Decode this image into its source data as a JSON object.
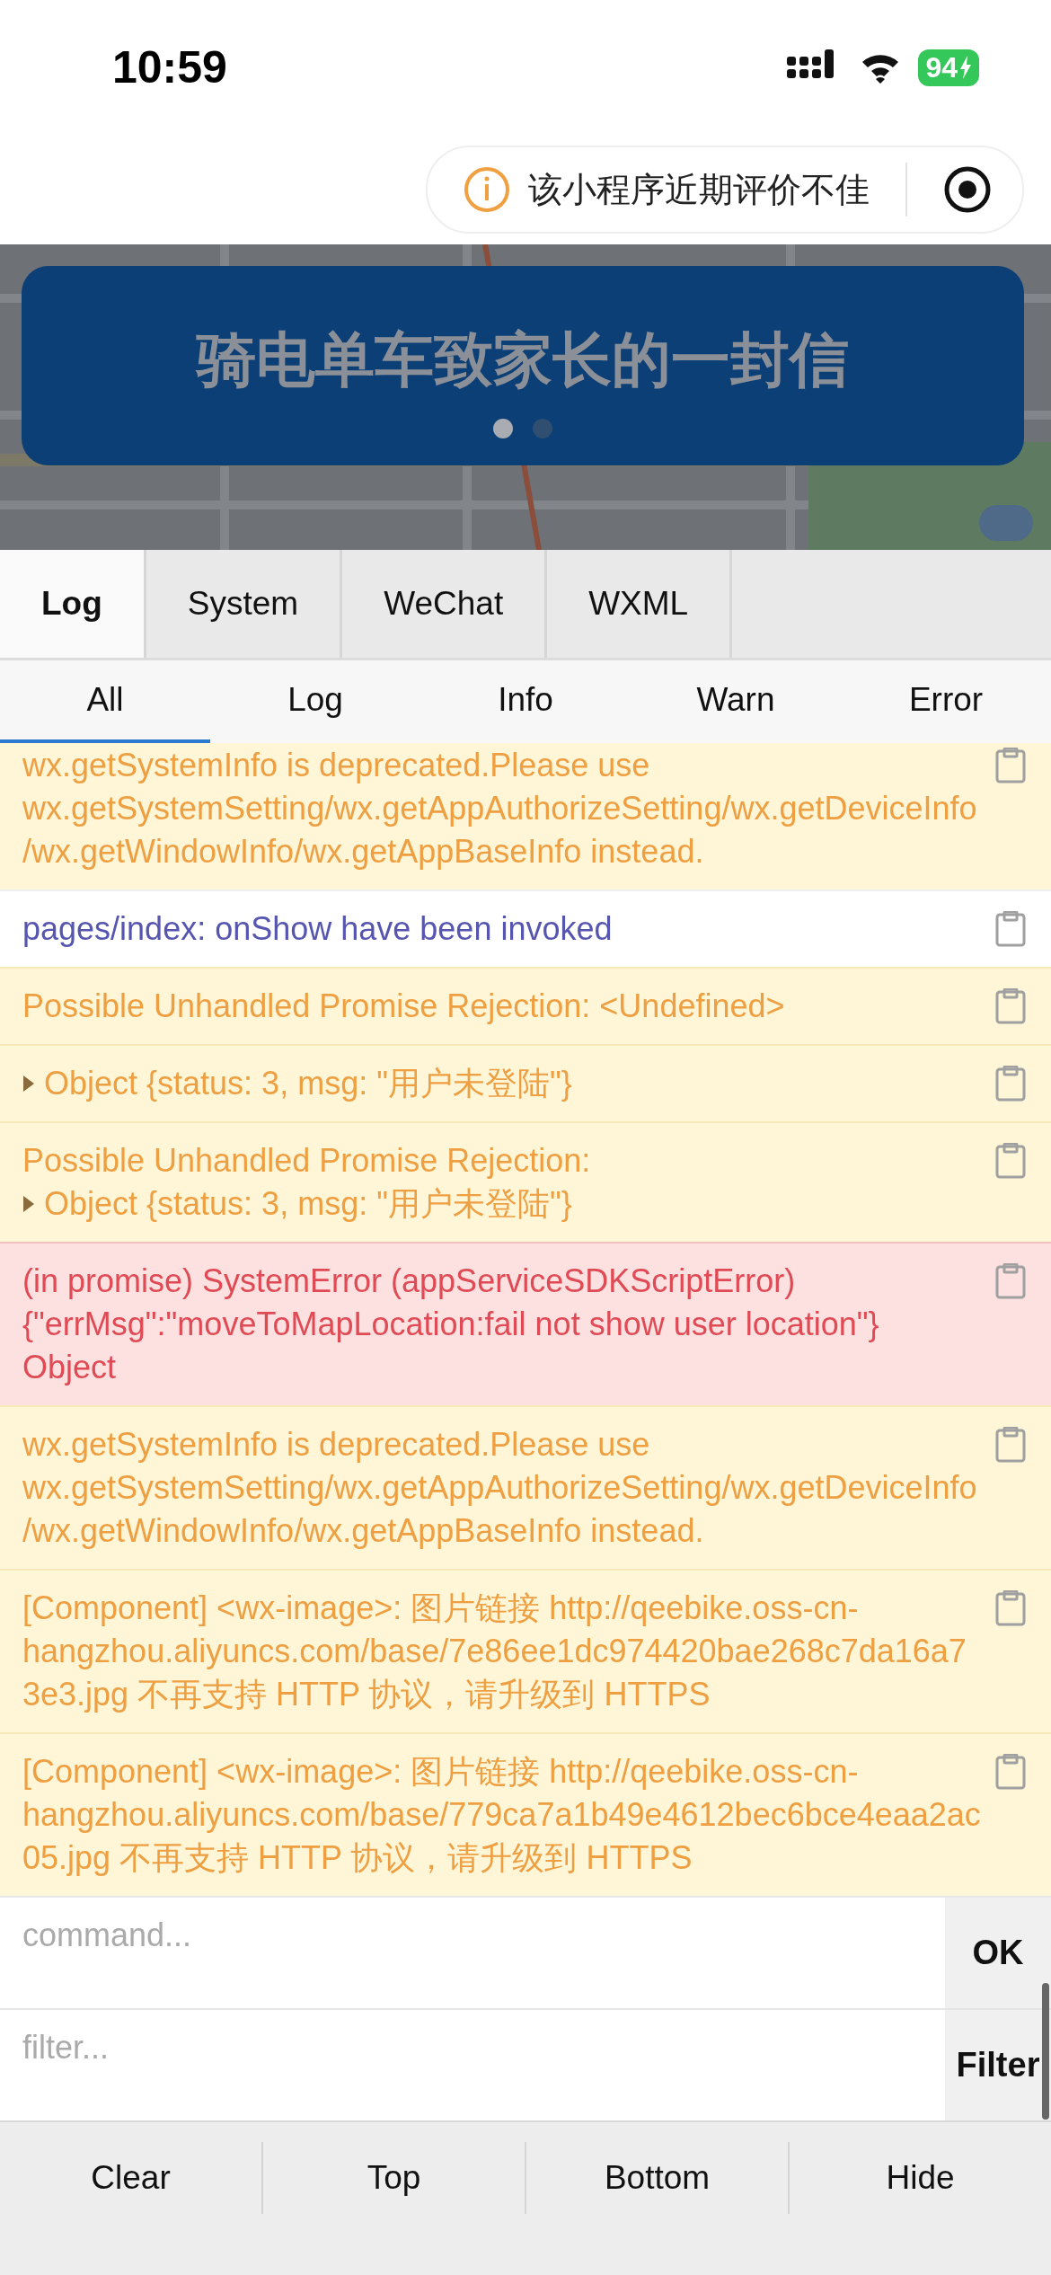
{
  "status_bar": {
    "time": "10:59",
    "battery": "94"
  },
  "capsule": {
    "notice": "该小程序近期评价不佳"
  },
  "banner": {
    "title": "骑电单车致家长的一封信",
    "dots": [
      {
        "selected": true
      },
      {
        "selected": false
      }
    ]
  },
  "tabs": [
    {
      "label": "Log",
      "selected": true
    },
    {
      "label": "System",
      "selected": false
    },
    {
      "label": "WeChat",
      "selected": false
    },
    {
      "label": "WXML",
      "selected": false
    }
  ],
  "filters": [
    {
      "label": "All",
      "selected": true
    },
    {
      "label": "Log",
      "selected": false
    },
    {
      "label": "Info",
      "selected": false
    },
    {
      "label": "Warn",
      "selected": false
    },
    {
      "label": "Error",
      "selected": false
    }
  ],
  "logs": [
    {
      "kind": "warn",
      "message": "wx.getSystemInfo is deprecated.Please use wx.getSystemSetting/wx.getAppAuthorizeSetting/wx.getDeviceInfo/wx.getWindowInfo/wx.getAppBaseInfo instead."
    },
    {
      "kind": "log",
      "message": "pages/index: onShow have been invoked"
    },
    {
      "kind": "warn",
      "message": "Possible Unhandled Promise Rejection: <Undefined>"
    },
    {
      "kind": "warn",
      "object": {
        "text": "Object {status: 3, msg: \"用户未登陆\"}",
        "expanded": false
      }
    },
    {
      "kind": "warn",
      "message": "Possible Unhandled Promise Rejection:",
      "object": {
        "text": "Object {status: 3, msg: \"用户未登陆\"}",
        "expanded": false
      }
    },
    {
      "kind": "error",
      "message": "(in promise) SystemError (appServiceSDKScriptError)\n{\"errMsg\":\"moveToMapLocation:fail not show user location\"}\nObject"
    },
    {
      "kind": "warn",
      "message": "wx.getSystemInfo is deprecated.Please use wx.getSystemSetting/wx.getAppAuthorizeSetting/wx.getDeviceInfo/wx.getWindowInfo/wx.getAppBaseInfo instead."
    },
    {
      "kind": "warn",
      "message": "[Component] <wx-image>: 图片链接 http://qeebike.oss-cn-hangzhou.aliyuncs.com/base/7e86ee1dc974420bae268c7da16a73e3.jpg 不再支持 HTTP 协议，请升级到 HTTPS"
    },
    {
      "kind": "warn",
      "message": "[Component] <wx-image>: 图片链接 http://qeebike.oss-cn-hangzhou.aliyuncs.com/base/779ca7a1b49e4612bec6bce4eaa2ac05.jpg 不再支持 HTTP 协议，请升级到 HTTPS"
    }
  ],
  "command": {
    "placeholder": "command...",
    "button": "OK"
  },
  "filter": {
    "placeholder": "filter...",
    "button": "Filter"
  },
  "actions": [
    "Clear",
    "Top",
    "Bottom",
    "Hide"
  ]
}
